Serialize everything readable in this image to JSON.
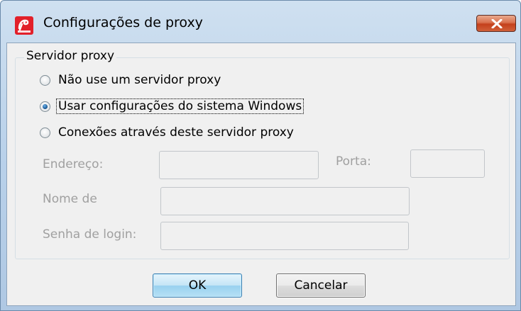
{
  "window": {
    "title": "Configurações de proxy",
    "app_icon": "avira-umbrella-icon",
    "close_icon": "close-x-icon"
  },
  "group": {
    "legend": "Servidor proxy"
  },
  "radios": [
    {
      "label": "Não use um servidor proxy",
      "checked": false
    },
    {
      "label": "Usar configurações do sistema Windows",
      "checked": true
    },
    {
      "label": "Conexões através deste servidor proxy",
      "checked": false
    }
  ],
  "fields": {
    "address_label": "Endereço:",
    "address_value": "",
    "port_label": "Porta:",
    "port_value": "",
    "login_name_label": "Nome de",
    "login_name_value": "",
    "password_label": "Senha de login:",
    "password_value": ""
  },
  "buttons": {
    "ok": "OK",
    "cancel": "Cancelar"
  },
  "colors": {
    "accent": "#3c7fb1",
    "disabled_text": "#a0a0a0",
    "close_red": "#c4401c",
    "brand_red": "#e2202a"
  }
}
